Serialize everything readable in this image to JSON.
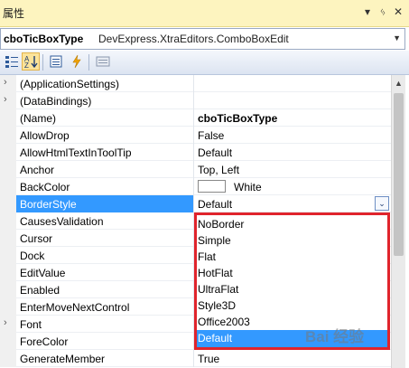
{
  "panel": {
    "title": "属性",
    "pin_glyph": "▾",
    "pin2_glyph": "ᛃ",
    "close_glyph": "✕"
  },
  "selector": {
    "name": "cboTicBoxType",
    "type": "DevExpress.XtraEditors.ComboBoxEdit"
  },
  "toolbar": {
    "buttons": [
      "categorized-icon",
      "alphabetical-icon",
      "properties-icon",
      "events-icon",
      "property-pages-icon"
    ],
    "active": "alphabetical-icon"
  },
  "properties": [
    {
      "name": "(ApplicationSettings)",
      "value": "",
      "expandable": true
    },
    {
      "name": "(DataBindings)",
      "value": "",
      "expandable": true
    },
    {
      "name": "(Name)",
      "value": "cboTicBoxType",
      "bold": true
    },
    {
      "name": "AllowDrop",
      "value": "False"
    },
    {
      "name": "AllowHtmlTextInToolTip",
      "value": "Default"
    },
    {
      "name": "Anchor",
      "value": "Top, Left"
    },
    {
      "name": "BackColor",
      "value": "White",
      "swatch": "#ffffff"
    },
    {
      "name": "BorderStyle",
      "value": "Default",
      "selected": true
    },
    {
      "name": "CausesValidation",
      "value": ""
    },
    {
      "name": "Cursor",
      "value": ""
    },
    {
      "name": "Dock",
      "value": ""
    },
    {
      "name": "EditValue",
      "value": ""
    },
    {
      "name": "Enabled",
      "value": ""
    },
    {
      "name": "EnterMoveNextControl",
      "value": ""
    },
    {
      "name": "Font",
      "value": "",
      "expandable": true
    },
    {
      "name": "ForeColor",
      "value": ""
    },
    {
      "name": "GenerateMember",
      "value": "True"
    }
  ],
  "dropdown": {
    "options": [
      "NoBorder",
      "Simple",
      "Flat",
      "HotFlat",
      "UltraFlat",
      "Style3D",
      "Office2003",
      "Default"
    ],
    "selected": "Default",
    "highlight_color": "#e0242c"
  },
  "watermark": "Bai 经验"
}
